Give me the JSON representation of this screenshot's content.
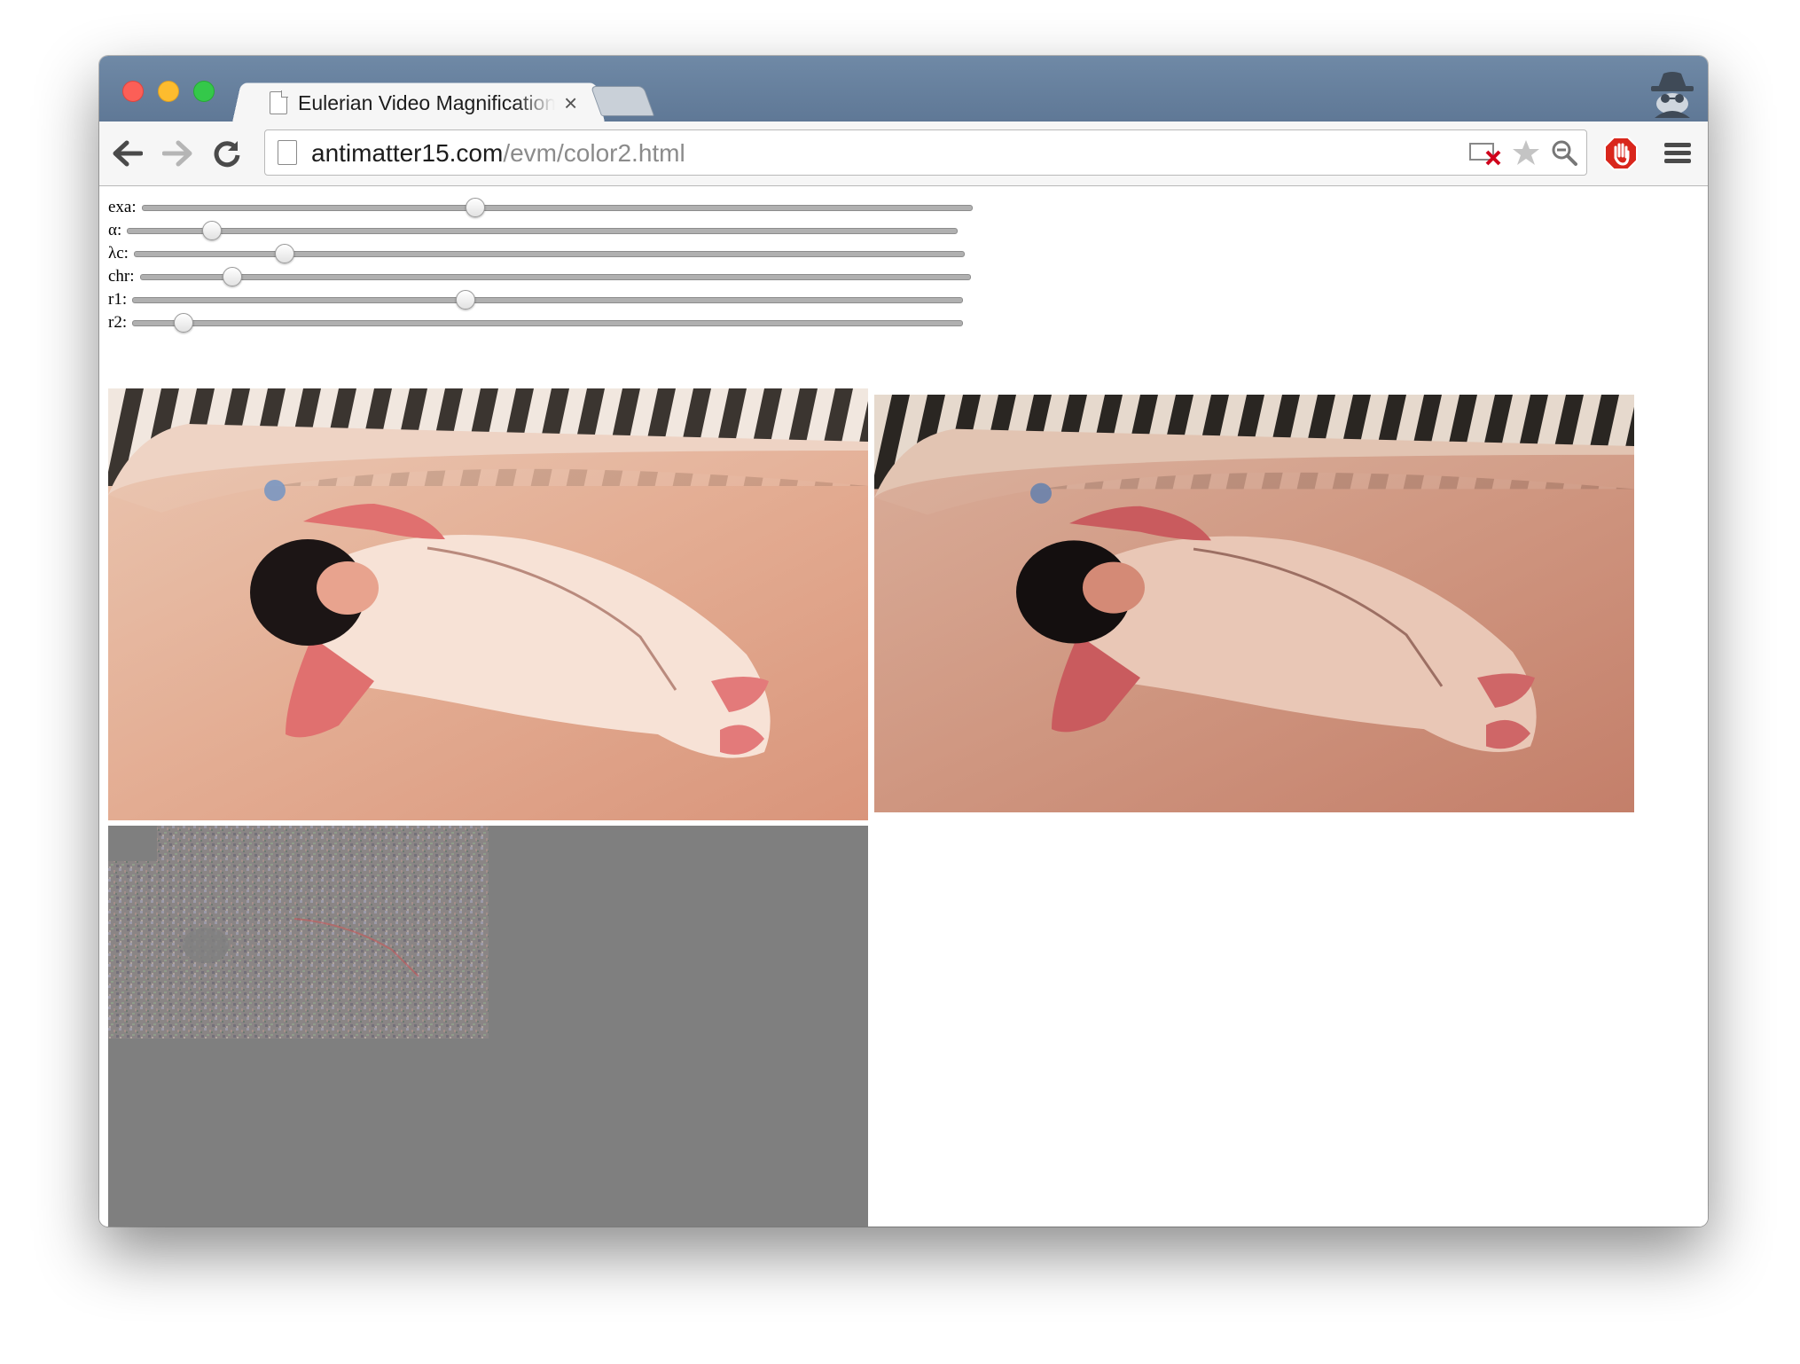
{
  "browser": {
    "tab_title": "Eulerian Video Magnification",
    "tab_close_glyph": "×",
    "url_host": "antimatter15.com",
    "url_path": "/evm/color2.html",
    "icons": [
      "back-icon",
      "forward-icon",
      "reload-icon",
      "page-icon",
      "blocked-video-icon",
      "star-icon",
      "zoom-icon",
      "adblock-icon",
      "menu-icon",
      "incognito-icon"
    ]
  },
  "controls": {
    "sliders": [
      {
        "label": "exa:",
        "value_fraction": 0.4
      },
      {
        "label": "α:",
        "value_fraction": 0.1
      },
      {
        "label": "λc:",
        "value_fraction": 0.18
      },
      {
        "label": "chr:",
        "value_fraction": 0.11
      },
      {
        "label": "r1:",
        "value_fraction": 0.4
      },
      {
        "label": "r2:",
        "value_fraction": 0.06
      }
    ]
  },
  "colors": {
    "titlebar": "#6b84a1",
    "toolbar": "#f6f6f6",
    "canvas_gray": "#7f7f7f"
  },
  "canvases": [
    {
      "name": "original-video",
      "subject": "sleeping-baby-in-crib"
    },
    {
      "name": "magnified-video",
      "subject": "sleeping-baby-in-crib-color-amplified"
    },
    {
      "name": "difference-signal",
      "subject": "noise-pattern"
    }
  ]
}
